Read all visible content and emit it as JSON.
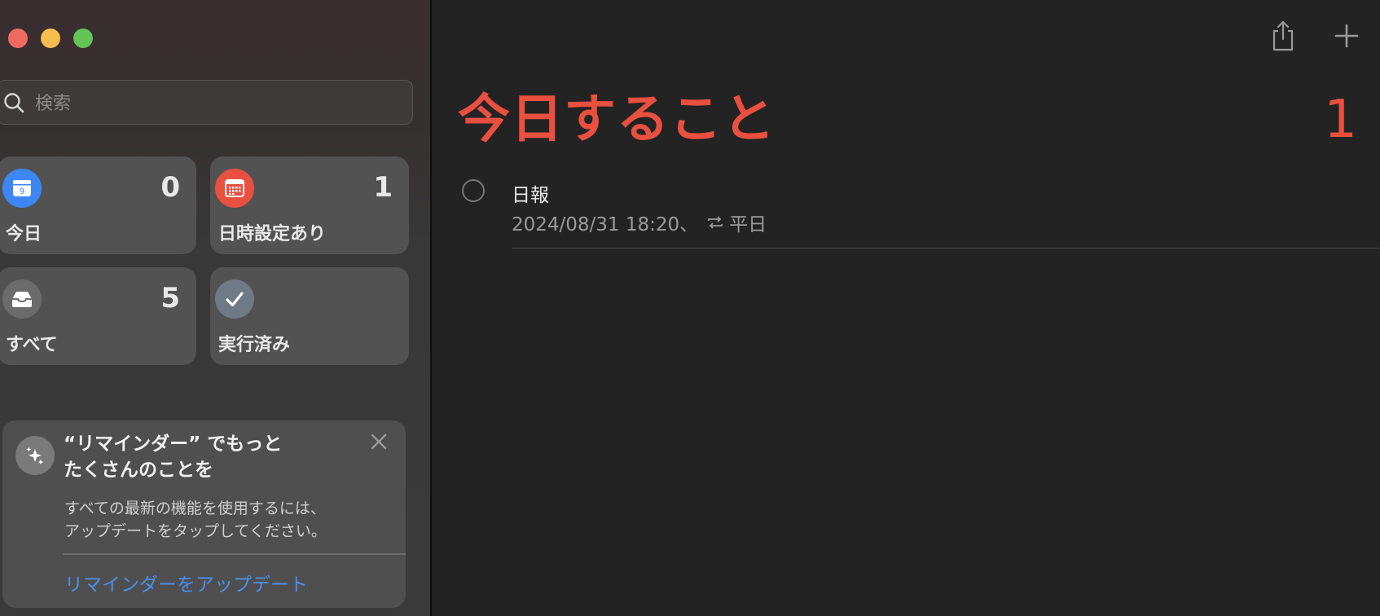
{
  "window": {
    "controls": [
      "close",
      "minimize",
      "zoom"
    ]
  },
  "sidebar": {
    "search": {
      "placeholder": "検索",
      "value": ""
    },
    "smart_lists": [
      {
        "label": "今日",
        "count": "0",
        "icon": "calendar-today-icon",
        "icon_color": "#3d87f5",
        "icon_day": "9"
      },
      {
        "label": "日時設定あり",
        "count": "1",
        "icon": "calendar-grid-icon",
        "icon_color": "#e9503f"
      },
      {
        "label": "すべて",
        "count": "5",
        "icon": "inbox-tray-icon",
        "icon_color": "#6b6b6b"
      },
      {
        "label": "実行済み",
        "count": "",
        "icon": "checkmark-icon",
        "icon_color": "#6e7b87"
      }
    ],
    "promo": {
      "icon": "sparkles-icon",
      "title_line1": "“リマインダー” でもっと",
      "title_line2": "たくさんのことを",
      "body_line1": "すべての最新の機能を使用するには、",
      "body_line2": "アップデートをタップしてください。",
      "link": "リマインダーをアップデート",
      "close_icon": "close-icon"
    }
  },
  "main": {
    "toolbar": {
      "share_icon": "share-icon",
      "add_icon": "plus-icon"
    },
    "title": "今日すること",
    "count": "1",
    "accent_color": "#e9503f",
    "tasks": [
      {
        "title": "日報",
        "date": "2024/08/31 18:20、",
        "repeat_icon": "repeat-icon",
        "repeat": "平日"
      }
    ]
  }
}
